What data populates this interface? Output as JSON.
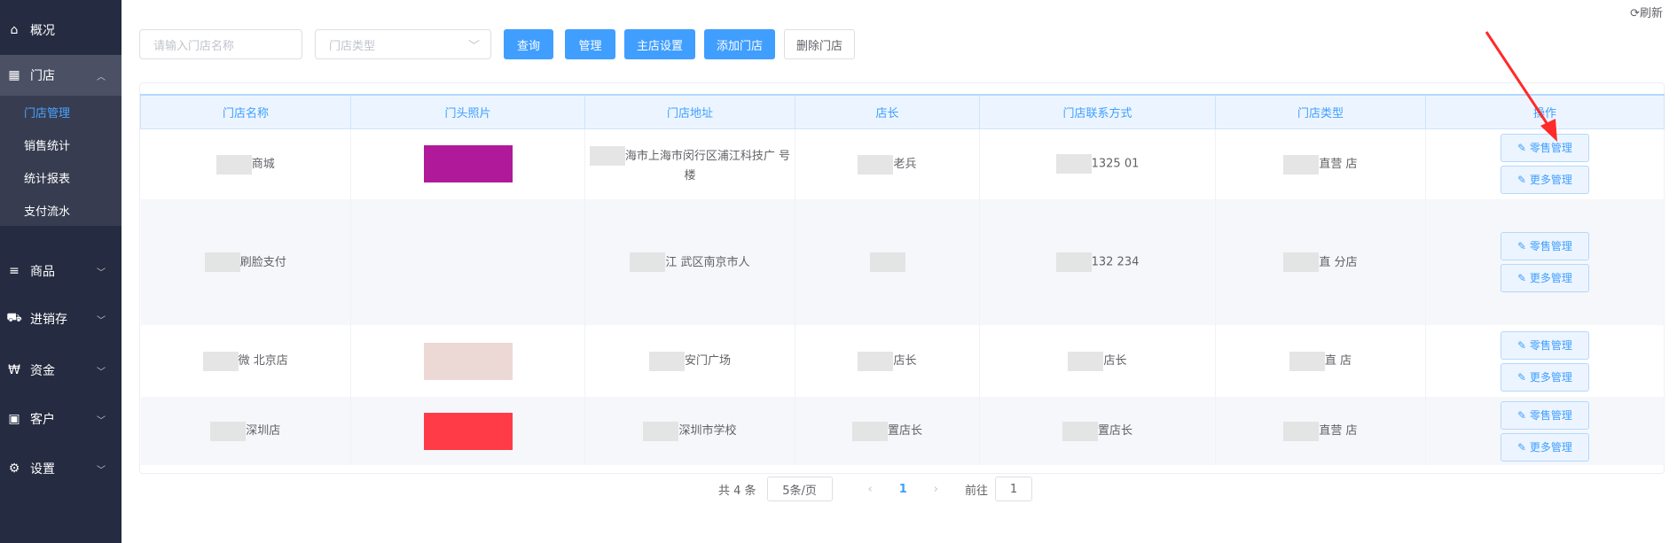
{
  "sidebar": {
    "items": [
      {
        "label": "概况",
        "icon": "home-icon",
        "glyph": "⌂"
      },
      {
        "label": "门店",
        "icon": "building-icon",
        "glyph": "▦",
        "open": true
      },
      {
        "label": "商品",
        "icon": "list-icon",
        "glyph": "≡"
      },
      {
        "label": "进销存",
        "icon": "truck-icon",
        "glyph": "⛟"
      },
      {
        "label": "资金",
        "icon": "won-icon",
        "glyph": "₩"
      },
      {
        "label": "客户",
        "icon": "id-card-icon",
        "glyph": "▣"
      },
      {
        "label": "设置",
        "icon": "gear-icon",
        "glyph": "⚙"
      }
    ],
    "submenu": [
      "门店管理",
      "销售统计",
      "统计报表",
      "支付流水"
    ]
  },
  "toolbar": {
    "name_placeholder": "请输入门店名称",
    "type_placeholder": "门店类型",
    "query": "查询",
    "manage": "管理",
    "main_store": "主店设置",
    "add": "添加门店",
    "delete": "删除门店",
    "refresh": "刷新"
  },
  "table": {
    "headers": [
      "门店名称",
      "门头照片",
      "门店地址",
      "店长",
      "门店联系方式",
      "门店类型",
      "操作"
    ],
    "rows": [
      {
        "name": "商城",
        "address": "海市上海市闵行区浦江科技广 号楼",
        "manager": "老兵",
        "phone": "1325 01",
        "type": "直营 店",
        "photo": "#b0199a"
      },
      {
        "name": "刷脸支付",
        "address": "江 武区南京市人",
        "manager": "",
        "phone": "132 234",
        "type": "直 分店",
        "photo": "#f1f1f1"
      },
      {
        "name": "微 北京店",
        "address": "安门广场",
        "manager": "店长",
        "phone": "店长",
        "type": "直 店",
        "photo": "#ecd8d4"
      },
      {
        "name": "深圳店",
        "address": "深圳市学校",
        "manager": "置店长",
        "phone": "置店长",
        "type": "直营 店",
        "photo": "#ff3b47"
      }
    ],
    "op1": "零售管理",
    "op2": "更多管理"
  },
  "pagination": {
    "total": "共 4 条",
    "page_size": "5条/页",
    "current": "1",
    "goto_label": "前往",
    "goto_value": "1"
  },
  "colors": {
    "primary": "#409eff",
    "sidebar": "#252b40",
    "annotation_arrow": "#ff2a2a"
  }
}
